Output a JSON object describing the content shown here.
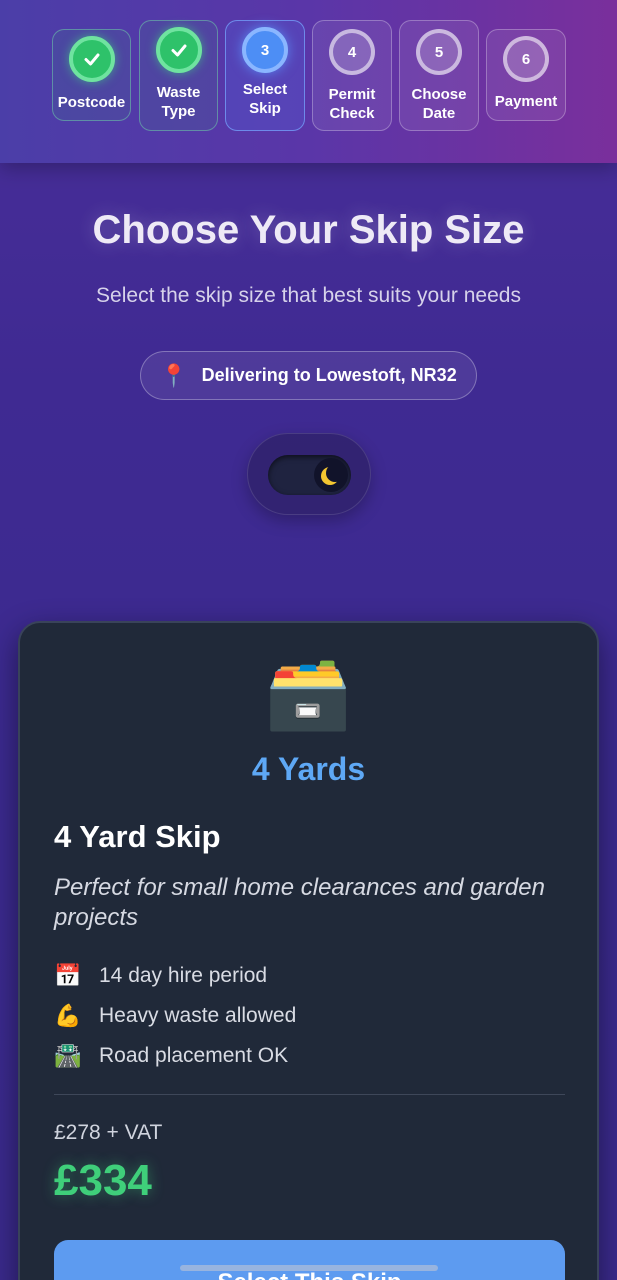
{
  "stepper": {
    "steps": [
      {
        "number": "",
        "label": "Postcode",
        "state": "done"
      },
      {
        "number": "",
        "label": "Waste\nType",
        "state": "done"
      },
      {
        "number": "3",
        "label": "Select\nSkip",
        "state": "active"
      },
      {
        "number": "4",
        "label": "Permit\nCheck",
        "state": "todo"
      },
      {
        "number": "5",
        "label": "Choose\nDate",
        "state": "todo"
      },
      {
        "number": "6",
        "label": "Payment",
        "state": "todo"
      }
    ]
  },
  "header": {
    "title": "Choose Your Skip Size",
    "subtitle": "Select the skip size that best suits your needs",
    "location": "Delivering to Lowestoft, NR32",
    "location_icon": "📍"
  },
  "theme_toggle": {
    "mode": "dark",
    "icon": "moon-icon"
  },
  "card": {
    "icon": "🗃️",
    "size_label": "4 Yards",
    "name": "4 Yard Skip",
    "description": "Perfect for small home clearances and garden projects",
    "features": [
      {
        "icon": "📅",
        "text": "14 day hire period"
      },
      {
        "icon": "💪",
        "text": "Heavy waste allowed"
      },
      {
        "icon": "🛣️",
        "text": "Road placement OK"
      }
    ],
    "price_net": "£278 + VAT",
    "price_gross": "£334",
    "button_label": "Select This Skip"
  },
  "colors": {
    "accent_blue": "#5d9bf0",
    "price_green": "#3fcf7a",
    "done_green": "#2ec26a",
    "card_bg": "#202939"
  }
}
